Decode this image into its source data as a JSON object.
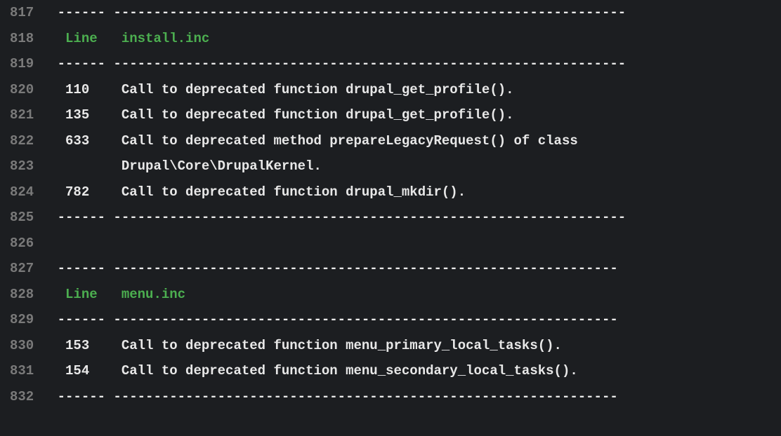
{
  "lines": [
    {
      "num": "817",
      "segments": [
        {
          "text": " ------ ---------------------------------------------------------------- ",
          "class": "white"
        }
      ]
    },
    {
      "num": "818",
      "segments": [
        {
          "text": "  ",
          "class": "white"
        },
        {
          "text": "Line   install.inc",
          "class": "green"
        },
        {
          "text": "                                                      ",
          "class": "white"
        }
      ]
    },
    {
      "num": "819",
      "segments": [
        {
          "text": " ------ ---------------------------------------------------------------- ",
          "class": "white"
        }
      ]
    },
    {
      "num": "820",
      "segments": [
        {
          "text": "  110    Call to deprecated function drupal_get_profile().               ",
          "class": "white"
        }
      ]
    },
    {
      "num": "821",
      "segments": [
        {
          "text": "  135    Call to deprecated function drupal_get_profile().               ",
          "class": "white"
        }
      ]
    },
    {
      "num": "822",
      "segments": [
        {
          "text": "  633    Call to deprecated method prepareLegacyRequest() of class       ",
          "class": "white"
        }
      ]
    },
    {
      "num": "823",
      "segments": [
        {
          "text": "         Drupal\\Core\\DrupalKernel.                                       ",
          "class": "white"
        }
      ]
    },
    {
      "num": "824",
      "segments": [
        {
          "text": "  782    Call to deprecated function drupal_mkdir().                     ",
          "class": "white"
        }
      ]
    },
    {
      "num": "825",
      "segments": [
        {
          "text": " ------ ---------------------------------------------------------------- ",
          "class": "white"
        }
      ]
    },
    {
      "num": "826",
      "segments": [
        {
          "text": "",
          "class": "white"
        }
      ]
    },
    {
      "num": "827",
      "segments": [
        {
          "text": " ------ --------------------------------------------------------------- ",
          "class": "white"
        }
      ]
    },
    {
      "num": "828",
      "segments": [
        {
          "text": "  ",
          "class": "white"
        },
        {
          "text": "Line   menu.inc",
          "class": "green"
        },
        {
          "text": "                                                        ",
          "class": "white"
        }
      ]
    },
    {
      "num": "829",
      "segments": [
        {
          "text": " ------ --------------------------------------------------------------- ",
          "class": "white"
        }
      ]
    },
    {
      "num": "830",
      "segments": [
        {
          "text": "  153    Call to deprecated function menu_primary_local_tasks().        ",
          "class": "white"
        }
      ]
    },
    {
      "num": "831",
      "segments": [
        {
          "text": "  154    Call to deprecated function menu_secondary_local_tasks().      ",
          "class": "white"
        }
      ]
    },
    {
      "num": "832",
      "segments": [
        {
          "text": " ------ --------------------------------------------------------------- ",
          "class": "white"
        }
      ]
    }
  ]
}
